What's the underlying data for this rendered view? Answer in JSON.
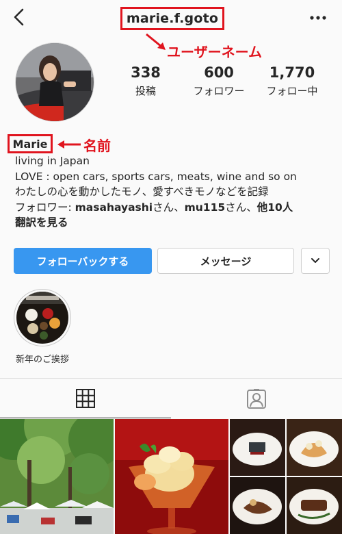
{
  "profile": {
    "username": "marie.f.goto",
    "display_name": "Marie",
    "avatar_icon": "profile-photo"
  },
  "annotations": {
    "username_label": "ユーザーネーム",
    "name_label": "名前",
    "color": "#e0141e"
  },
  "stats": {
    "posts": {
      "value": "338",
      "label": "投稿"
    },
    "followers": {
      "value": "600",
      "label": "フォロワー"
    },
    "following": {
      "value": "1,770",
      "label": "フォロー中"
    }
  },
  "bio": {
    "line1": "living in Japan",
    "line2": "LOVE : open cars, sports cars, meats, wine and so on",
    "line3": "わたしの心を動かしたモノ、愛すべきモノなどを記録",
    "followed_by_prefix": "フォロワー: ",
    "followed_by_user1": "masahayashi",
    "san1": "さん、",
    "followed_by_user2": "mu115",
    "san2": "さん、",
    "followed_by_more": "他10人",
    "translate": "翻訳を見る"
  },
  "buttons": {
    "follow_back": "フォローバックする",
    "message": "メッセージ",
    "dropdown_icon": "chevron-down-icon",
    "accent_color": "#3897f0"
  },
  "highlights": [
    {
      "label": "新年のご挨拶"
    }
  ],
  "tabs": {
    "grid_icon": "grid-icon",
    "tagged_icon": "tagged-person-icon"
  },
  "posts": [
    {
      "subject": "tree-lined-market"
    },
    {
      "subject": "ice-cream-dessert"
    },
    {
      "subject": "four-dishes-collage"
    }
  ]
}
